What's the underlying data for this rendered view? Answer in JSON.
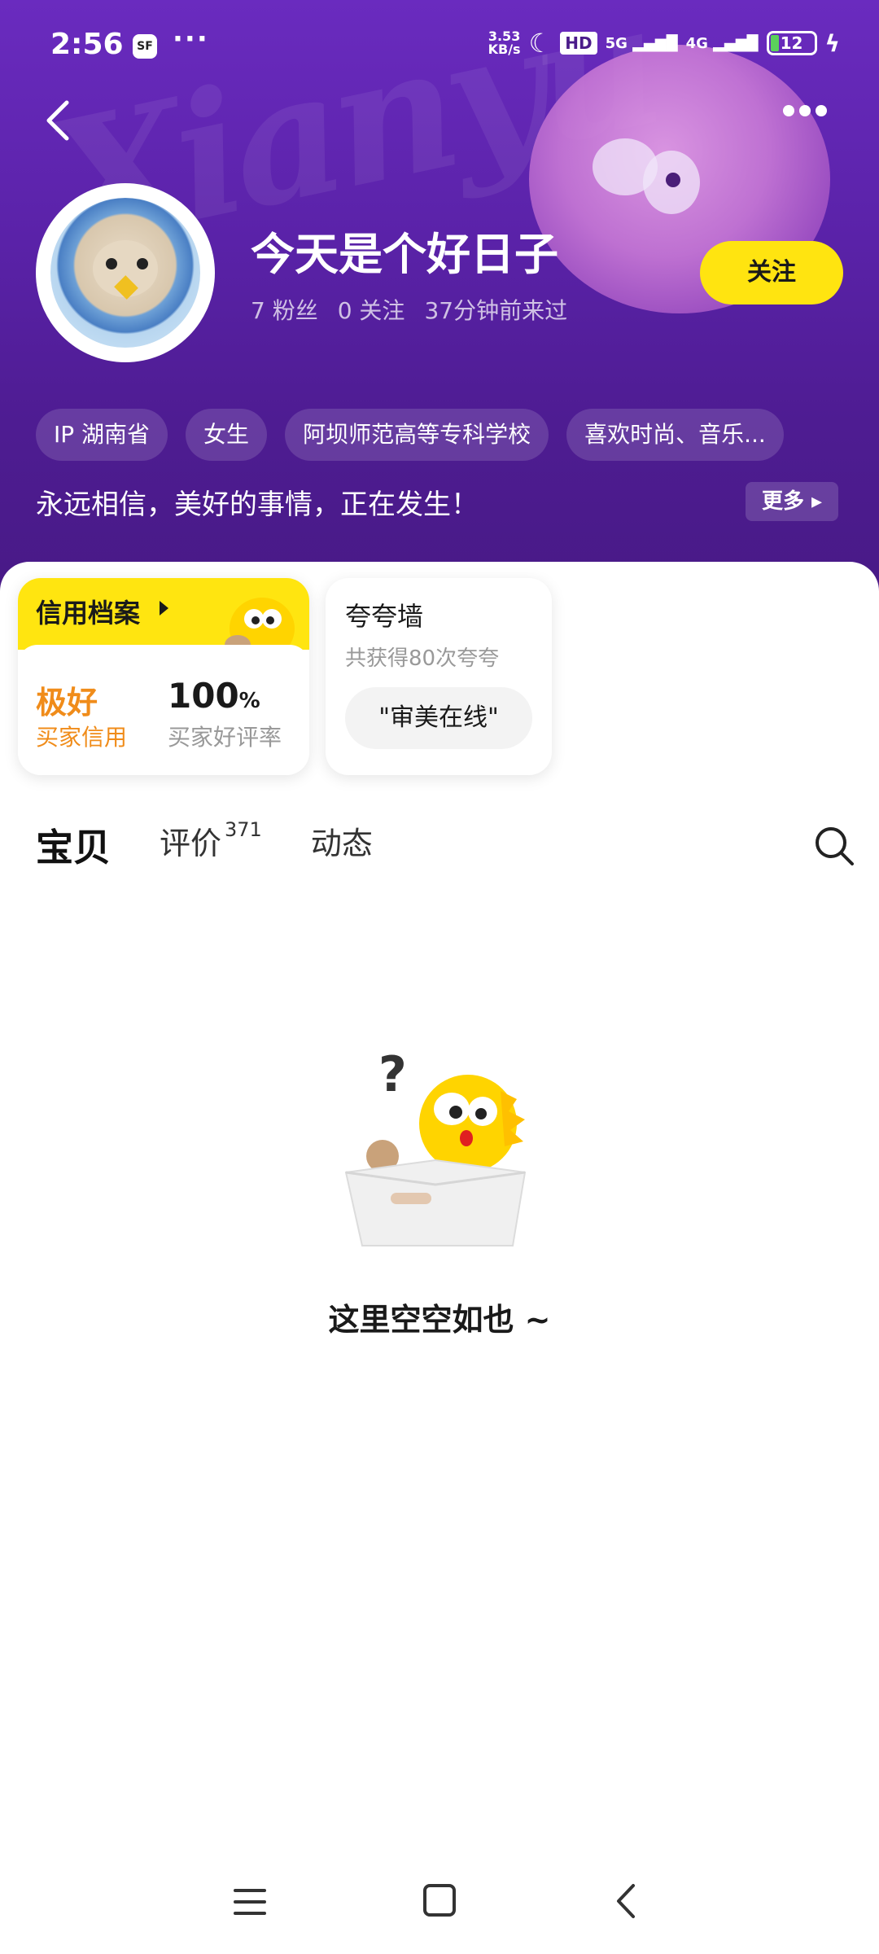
{
  "status_bar": {
    "time": "2:56",
    "badge": "SF",
    "more": "···",
    "net_speed": "3.53\nKB/s",
    "hd": "HD",
    "net1": "5G",
    "net2": "4G",
    "battery": "12"
  },
  "profile": {
    "name": "今天是个好日子",
    "fans": "7 粉丝",
    "following": "0 关注",
    "last_seen": "37分钟前来过",
    "follow_label": "关注"
  },
  "tags": [
    "IP 湖南省",
    "女生",
    "阿坝师范高等专科学校",
    "喜欢时尚、音乐..."
  ],
  "bio": {
    "text": "永远相信，美好的事情，正在发生！",
    "more_label": "更多"
  },
  "credit": {
    "title": "信用档案",
    "level": "极好",
    "level_label": "买家信用",
    "rate": "100",
    "rate_unit": "%",
    "rate_label": "买家好评率"
  },
  "praise": {
    "title": "夸夸墙",
    "count": "共获得80次夸夸",
    "chip": "\"审美在线\""
  },
  "tabs": [
    {
      "label": "宝贝",
      "badge": ""
    },
    {
      "label": "评价",
      "badge": "371"
    },
    {
      "label": "动态",
      "badge": ""
    }
  ],
  "empty": {
    "text": "这里空空如也 ~"
  },
  "colors": {
    "brand_yellow": "#ffe510",
    "header_purple": "#5a22a8",
    "credit_orange": "#f08c1a"
  }
}
